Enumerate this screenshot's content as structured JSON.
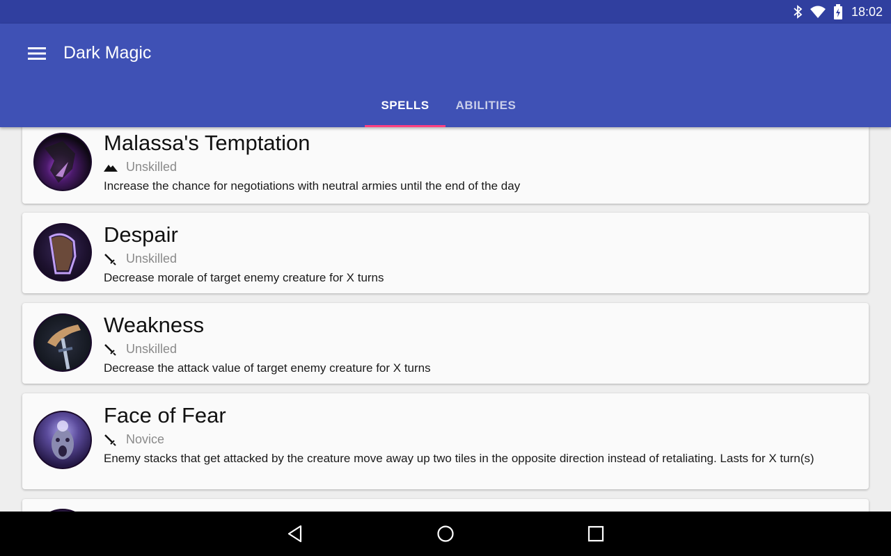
{
  "status_bar": {
    "time": "18:02",
    "icons": [
      "bluetooth-icon",
      "wifi-icon",
      "battery-icon"
    ]
  },
  "app_bar": {
    "title": "Dark Magic",
    "menu_icon": "hamburger-menu-icon"
  },
  "tabs": [
    {
      "label": "SPELLS",
      "active": true
    },
    {
      "label": "ABILITIES",
      "active": false
    }
  ],
  "spells": [
    {
      "name": "Malassa's Temptation",
      "type_icon": "mountain-icon",
      "level": "Unskilled",
      "description": "Increase the chance for negotiations with neutral armies until the end of the day"
    },
    {
      "name": "Despair",
      "type_icon": "sword-icon",
      "level": "Unskilled",
      "description": "Decrease morale of target enemy creature for X turns"
    },
    {
      "name": "Weakness",
      "type_icon": "sword-icon",
      "level": "Unskilled",
      "description": "Decrease the attack value of target enemy creature for X turns"
    },
    {
      "name": "Face of Fear",
      "type_icon": "sword-icon",
      "level": "Novice",
      "description": "Enemy stacks that get attacked by the creature move away up two tiles in the opposite direction instead of retaliating. Lasts for X turn(s)"
    }
  ],
  "nav_bar": {
    "buttons": [
      "back-icon",
      "home-icon",
      "recents-icon"
    ]
  },
  "colors": {
    "primary": "#3f51b5",
    "primary_dark": "#303f9f",
    "accent": "#ff4081",
    "background": "#eeeeee",
    "card": "#fafafa"
  }
}
